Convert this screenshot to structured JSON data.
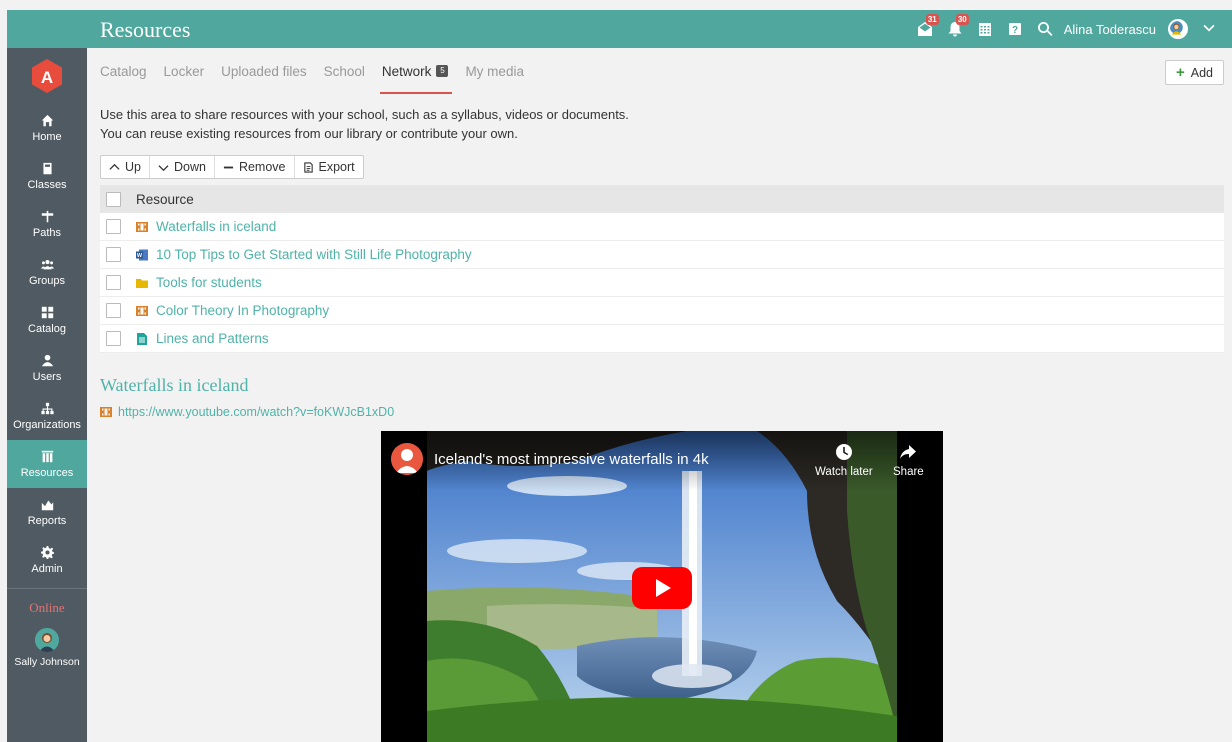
{
  "sidebar": {
    "logo_letter": "A",
    "items": [
      {
        "label": "Home",
        "icon": "home-icon"
      },
      {
        "label": "Classes",
        "icon": "book-icon"
      },
      {
        "label": "Paths",
        "icon": "signpost-icon"
      },
      {
        "label": "Groups",
        "icon": "group-icon"
      },
      {
        "label": "Catalog",
        "icon": "grid-icon"
      },
      {
        "label": "Users",
        "icon": "user-icon"
      },
      {
        "label": "Organizations",
        "icon": "org-chart-icon"
      },
      {
        "label": "Resources",
        "icon": "library-icon",
        "active": true
      },
      {
        "label": "Reports",
        "icon": "chart-icon"
      },
      {
        "label": "Admin",
        "icon": "gear-icon"
      }
    ],
    "online_label": "Online",
    "online_user": "Sally Johnson"
  },
  "header": {
    "title": "Resources",
    "messages_count": "31",
    "notifications_count": "30",
    "user_name": "Alina Toderascu"
  },
  "tabs": [
    {
      "label": "Catalog"
    },
    {
      "label": "Locker"
    },
    {
      "label": "Uploaded files"
    },
    {
      "label": "School"
    },
    {
      "label": "Network",
      "count": "5",
      "active": true
    },
    {
      "label": "My media"
    }
  ],
  "add_label": "Add",
  "description": {
    "line1": "Use this area to share resources with your school, such as a syllabus, videos or documents.",
    "line2": "You can reuse existing resources from our library or contribute your own."
  },
  "toolbar": {
    "up": "Up",
    "down": "Down",
    "remove": "Remove",
    "export": "Export"
  },
  "table": {
    "header": "Resource",
    "rows": [
      {
        "title": "Waterfalls in iceland",
        "type": "video-icon",
        "color": "#d9822b"
      },
      {
        "title": "10 Top Tips to Get Started with Still Life Photography",
        "type": "word-doc-icon",
        "color": "#2b5797"
      },
      {
        "title": "Tools for students",
        "type": "folder-icon",
        "color": "#e6b800"
      },
      {
        "title": "Color Theory In Photography",
        "type": "video-icon",
        "color": "#d9822b"
      },
      {
        "title": "Lines and Patterns",
        "type": "document-icon",
        "color": "#1fa39a"
      }
    ]
  },
  "detail": {
    "title": "Waterfalls in iceland",
    "url": "https://www.youtube.com/watch?v=foKWJcB1xD0"
  },
  "video": {
    "title": "Iceland's most impressive waterfalls in 4k",
    "watch_later": "Watch later",
    "share": "Share"
  },
  "colors": {
    "accent": "#4fa79e",
    "sidebar": "#505a62",
    "link": "#4fb3a9",
    "badge": "#d9534f"
  }
}
